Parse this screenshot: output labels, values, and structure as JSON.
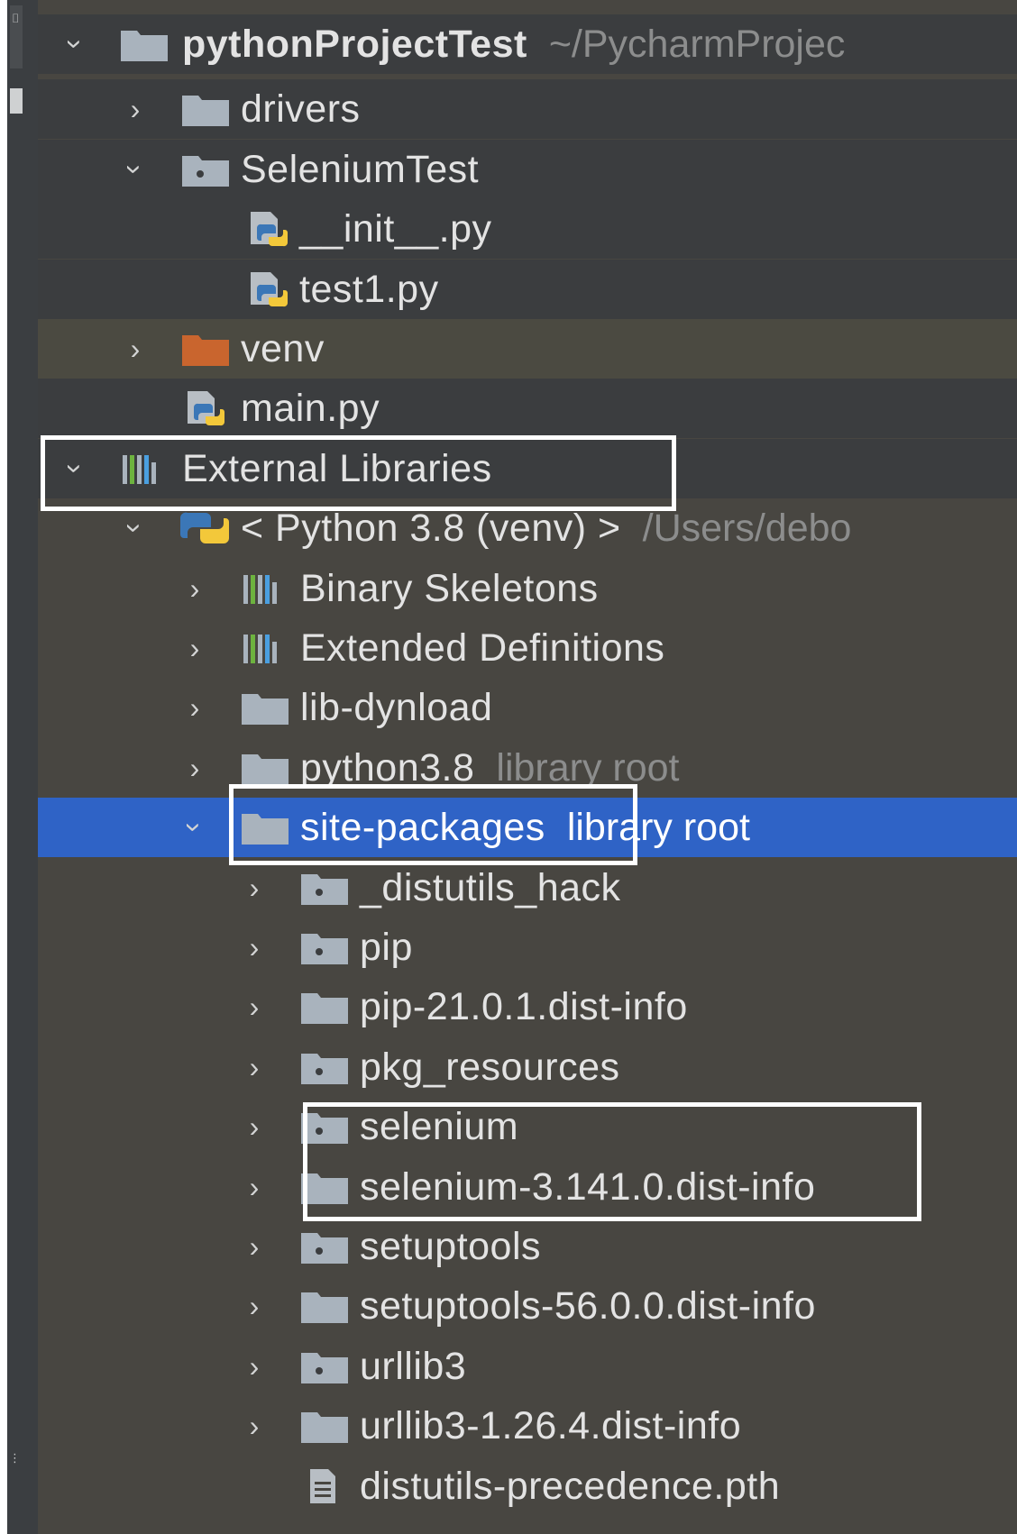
{
  "tree": {
    "rows": [
      {
        "id": "r0",
        "depth": 0,
        "expanded": true,
        "icon": "folder-icon",
        "label": "pythonProjectTest",
        "hint": "~/PycharmProjec",
        "bold": true,
        "bg": "plain"
      },
      {
        "id": "r1",
        "depth": 1,
        "expanded": false,
        "icon": "folder-icon",
        "label": "drivers",
        "bg": "plain"
      },
      {
        "id": "r2",
        "depth": 1,
        "expanded": true,
        "icon": "package-folder-icon",
        "label": "SeleniumTest",
        "bg": "plain"
      },
      {
        "id": "r3",
        "depth": 2,
        "expanded": null,
        "icon": "python-file-icon",
        "label": "__init__.py",
        "bg": "plain"
      },
      {
        "id": "r4",
        "depth": 2,
        "expanded": null,
        "icon": "python-file-icon",
        "label": "test1.py",
        "bg": "plain"
      },
      {
        "id": "r5",
        "depth": 1,
        "expanded": false,
        "icon": "excluded-folder-icon",
        "label": "venv",
        "bg": "venv"
      },
      {
        "id": "r6",
        "depth": 1,
        "expanded": null,
        "icon": "python-file-icon",
        "label": "main.py",
        "bg": "plain"
      },
      {
        "id": "r7",
        "depth": 0,
        "expanded": true,
        "icon": "library-icon",
        "label": "External Libraries",
        "bg": "plain"
      },
      {
        "id": "r8",
        "depth": 1,
        "expanded": true,
        "icon": "python-icon",
        "label": "< Python 3.8 (venv) >",
        "hint": "/Users/debo",
        "bg": "lib"
      },
      {
        "id": "r9",
        "depth": 2,
        "expanded": false,
        "icon": "library-icon",
        "label": "Binary Skeletons",
        "bg": "lib"
      },
      {
        "id": "r10",
        "depth": 2,
        "expanded": false,
        "icon": "library-icon",
        "label": "Extended Definitions",
        "bg": "lib"
      },
      {
        "id": "r11",
        "depth": 2,
        "expanded": false,
        "icon": "folder-icon",
        "label": "lib-dynload",
        "bg": "lib"
      },
      {
        "id": "r12",
        "depth": 2,
        "expanded": false,
        "icon": "folder-icon",
        "label": "python3.8",
        "hint": "library root",
        "bg": "lib"
      },
      {
        "id": "r13",
        "depth": 2,
        "expanded": true,
        "icon": "folder-icon",
        "label": "site-packages",
        "hint": "library root",
        "bg": "selected"
      },
      {
        "id": "r14",
        "depth": 3,
        "expanded": false,
        "icon": "package-folder-icon",
        "label": "_distutils_hack",
        "bg": "lib"
      },
      {
        "id": "r15",
        "depth": 3,
        "expanded": false,
        "icon": "package-folder-icon",
        "label": "pip",
        "bg": "lib"
      },
      {
        "id": "r16",
        "depth": 3,
        "expanded": false,
        "icon": "folder-icon",
        "label": "pip-21.0.1.dist-info",
        "bg": "lib"
      },
      {
        "id": "r17",
        "depth": 3,
        "expanded": false,
        "icon": "package-folder-icon",
        "label": "pkg_resources",
        "bg": "lib"
      },
      {
        "id": "r18",
        "depth": 3,
        "expanded": false,
        "icon": "package-folder-icon",
        "label": "selenium",
        "bg": "lib"
      },
      {
        "id": "r19",
        "depth": 3,
        "expanded": false,
        "icon": "folder-icon",
        "label": "selenium-3.141.0.dist-info",
        "bg": "lib"
      },
      {
        "id": "r20",
        "depth": 3,
        "expanded": false,
        "icon": "package-folder-icon",
        "label": "setuptools",
        "bg": "lib"
      },
      {
        "id": "r21",
        "depth": 3,
        "expanded": false,
        "icon": "folder-icon",
        "label": "setuptools-56.0.0.dist-info",
        "bg": "lib"
      },
      {
        "id": "r22",
        "depth": 3,
        "expanded": false,
        "icon": "package-folder-icon",
        "label": "urllib3",
        "bg": "lib"
      },
      {
        "id": "r23",
        "depth": 3,
        "expanded": false,
        "icon": "folder-icon",
        "label": "urllib3-1.26.4.dist-info",
        "bg": "lib"
      },
      {
        "id": "r24",
        "depth": 3,
        "expanded": null,
        "icon": "text-file-icon",
        "label": "distutils-precedence.pth",
        "bg": "lib"
      }
    ]
  },
  "colors": {
    "folder": "#a9b3bd",
    "excluded_folder": "#c9652e",
    "selection": "#2f63c6",
    "highlight_box": "#ffffff"
  }
}
